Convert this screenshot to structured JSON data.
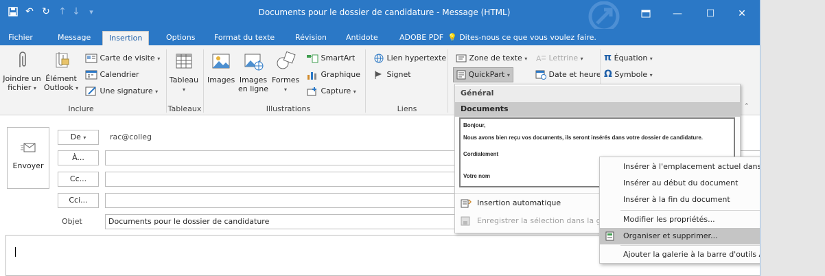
{
  "window": {
    "title": "Documents pour le dossier de candidature - Message (HTML)"
  },
  "tabs": [
    {
      "label": "Fichier"
    },
    {
      "label": "Message"
    },
    {
      "label": "Insertion"
    },
    {
      "label": "Options"
    },
    {
      "label": "Format du texte"
    },
    {
      "label": "Révision"
    },
    {
      "label": "Antidote"
    },
    {
      "label": "ADOBE PDF"
    }
  ],
  "tellme": "Dites-nous ce que vous voulez faire.",
  "ribbon": {
    "inclure": {
      "label": "Inclure",
      "joindre": "Joindre un",
      "joindre2": "fichier",
      "element": "Élément",
      "element2": "Outlook",
      "carte": "Carte de visite",
      "calendrier": "Calendrier",
      "signature": "Une signature"
    },
    "tableaux": {
      "label": "Tableaux",
      "tableau": "Tableau"
    },
    "illustrations": {
      "label": "Illustrations",
      "images": "Images",
      "images_en_ligne": "Images",
      "en_ligne": "en ligne",
      "formes": "Formes",
      "smartart": "SmartArt",
      "graphique": "Graphique",
      "capture": "Capture"
    },
    "liens": {
      "label": "Liens",
      "lien": "Lien hypertexte",
      "signet": "Signet"
    },
    "texte": {
      "zone": "Zone de texte",
      "lettrine": "Lettrine",
      "quickpart": "QuickPart",
      "date": "Date et heure"
    },
    "symboles": {
      "equation": "Équation",
      "symbole": "Symbole"
    }
  },
  "compose": {
    "send": "Envoyer",
    "from_label": "De",
    "from_value": "rac@colleg",
    "to_label": "À...",
    "cc_label": "Cc...",
    "bcc_label": "Cci...",
    "subject_label": "Objet",
    "subject_value": "Documents pour le dossier de candidature"
  },
  "quickpart": {
    "general": "Général",
    "documents": "Documents",
    "entry": {
      "line1": "Bonjour,",
      "line2": "Nous avons bien reçu vos documents, ils seront insérés dans votre dossier de candidature.",
      "line3": "Cordialement",
      "line4": "Votre nom"
    },
    "autotext": "Insertion automatique",
    "save": "Enregistrer la sélection dans la ga"
  },
  "context_menu": [
    {
      "label": "Insérer à l'emplacement actuel dans le document"
    },
    {
      "label": "Insérer au début du document"
    },
    {
      "label": "Insérer à la fin du document"
    },
    {
      "label": "Modifier les propriétés..."
    },
    {
      "label": "Organiser et supprimer..."
    },
    {
      "label": "Ajouter la galerie à la barre d'outils Accès rapide"
    }
  ],
  "colors": {
    "accent": "#2b78c6",
    "highlight": "#c5c5c5"
  }
}
